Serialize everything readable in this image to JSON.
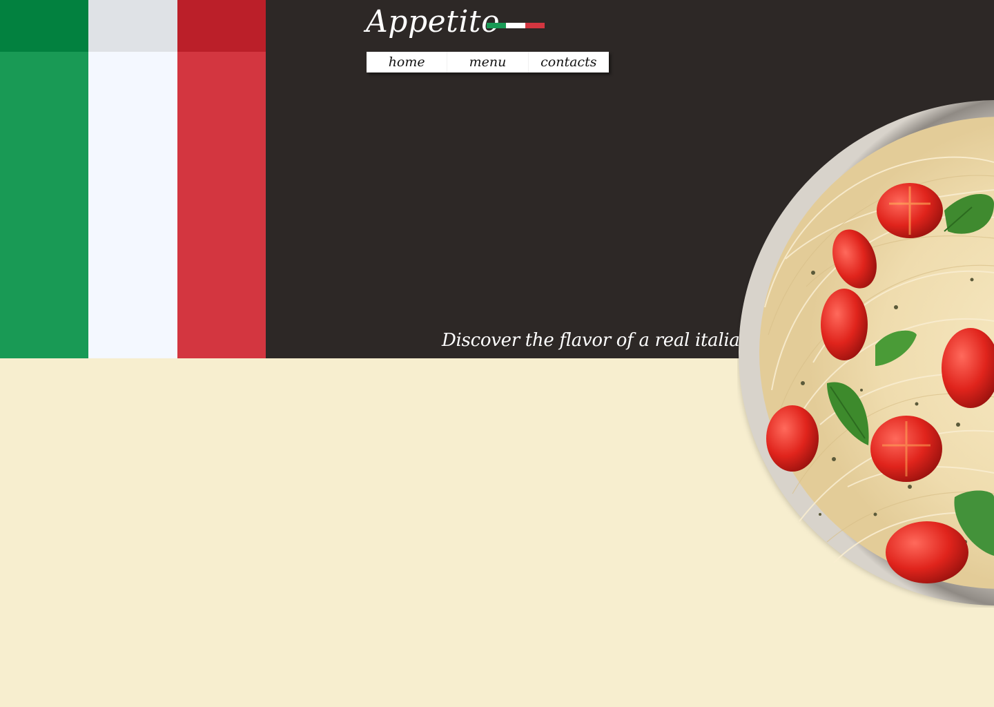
{
  "brand": {
    "name": "Appetito"
  },
  "nav": {
    "items": [
      {
        "label": "home"
      },
      {
        "label": "menu"
      },
      {
        "label": "contacts"
      }
    ]
  },
  "hero": {
    "tagline": "Discover the flavor of a real italian food!"
  },
  "colors": {
    "hero_background": "#2d2826",
    "page_background": "#f7eecf",
    "flag_green": "#199a55",
    "flag_white": "#f4f8ff",
    "flag_red": "#d33640"
  },
  "images": {
    "dish": "pasta-bowl-image"
  }
}
